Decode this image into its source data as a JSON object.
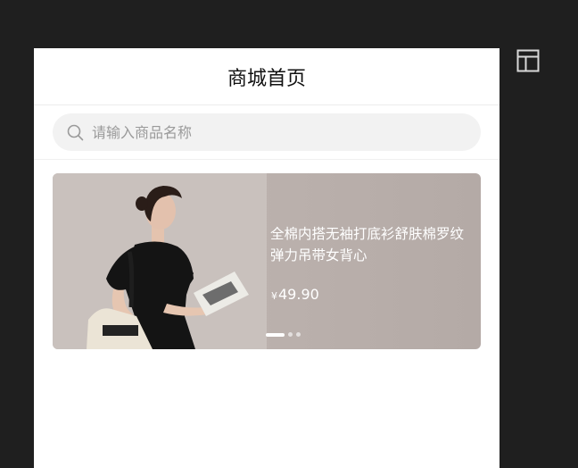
{
  "page": {
    "title": "商城首页"
  },
  "search": {
    "placeholder": "请输入商品名称",
    "value": ""
  },
  "banner": {
    "title": "全棉内搭无袖打底衫舒肤棉罗纹弹力吊带女背心",
    "currency": "¥",
    "price": "49.90",
    "slide_count": 3,
    "active_slide": 0
  },
  "icons": {
    "layout": "layout-icon",
    "search": "search-icon"
  },
  "colors": {
    "page_bg": "#1f1f1f",
    "banner_bg": "#b7aeaa",
    "search_bg": "#f2f2f2"
  }
}
